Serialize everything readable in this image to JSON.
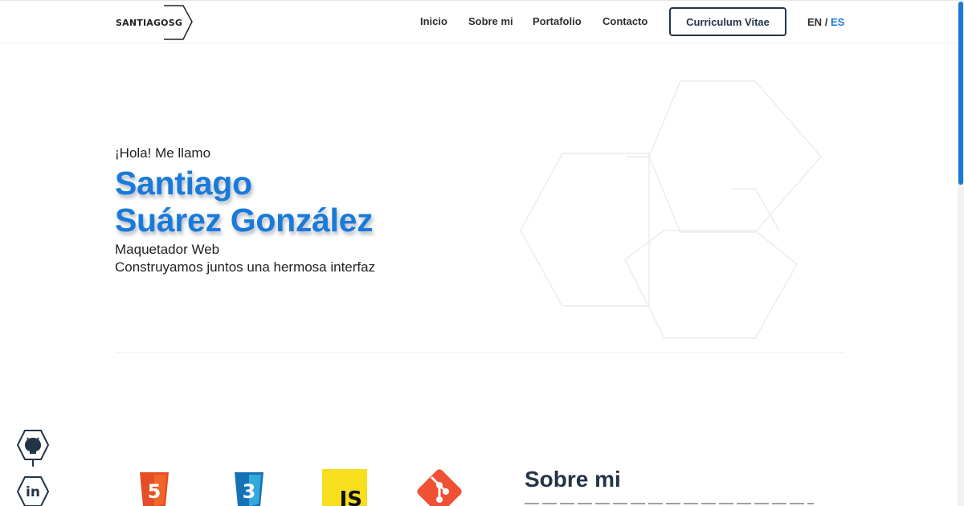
{
  "header": {
    "logo": "SANTIAGOSG",
    "nav": [
      "Inicio",
      "Sobre mi",
      "Portafolio",
      "Contacto"
    ],
    "cv_button": "Curriculum Vitae",
    "lang_en": "EN",
    "lang_sep": "/",
    "lang_es": "ES"
  },
  "hero": {
    "greeting": "¡Hola! Me llamo",
    "name_line1": "Santiago",
    "name_line2": "Suárez González",
    "role": "Maquetador Web",
    "tagline": "Construyamos juntos una hermosa interfaz"
  },
  "social": [
    "github-icon",
    "linkedin-icon"
  ],
  "skills": {
    "html_label": "5",
    "css_label": "3",
    "js_label": "JS",
    "git": "git-icon"
  },
  "about": {
    "title": "Sobre mi"
  },
  "colors": {
    "accent": "#1a7ad9",
    "dark": "#243447",
    "html": "#e44d26",
    "css": "#1572b6",
    "js": "#f7df1e",
    "git": "#f05033"
  }
}
